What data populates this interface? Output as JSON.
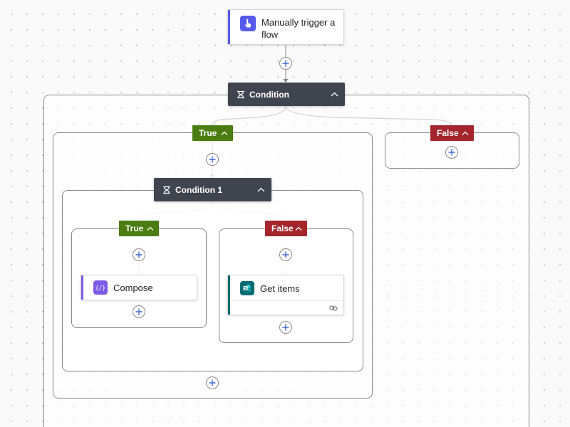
{
  "trigger": {
    "label": "Manually trigger a flow",
    "icon": "hand-touch-icon",
    "accent": "#5659ea"
  },
  "condition": {
    "label": "Condition",
    "icon": "condition-icon"
  },
  "condition1": {
    "label": "Condition 1",
    "icon": "condition-icon"
  },
  "branches": {
    "outer_true": "True",
    "outer_false": "False",
    "inner_true": "True",
    "inner_false": "False"
  },
  "actions": {
    "compose": {
      "label": "Compose",
      "icon": "compose-icon",
      "accent": "#7c5ce6"
    },
    "get_items": {
      "label": "Get items",
      "icon": "sharepoint-icon",
      "accent": "#036c70",
      "footer_icon": "link-icon"
    }
  },
  "colors": {
    "condition_header": "#40444f",
    "true_branch": "#4b7d12",
    "false_branch": "#a4262c",
    "connector": "#a19f9d"
  }
}
